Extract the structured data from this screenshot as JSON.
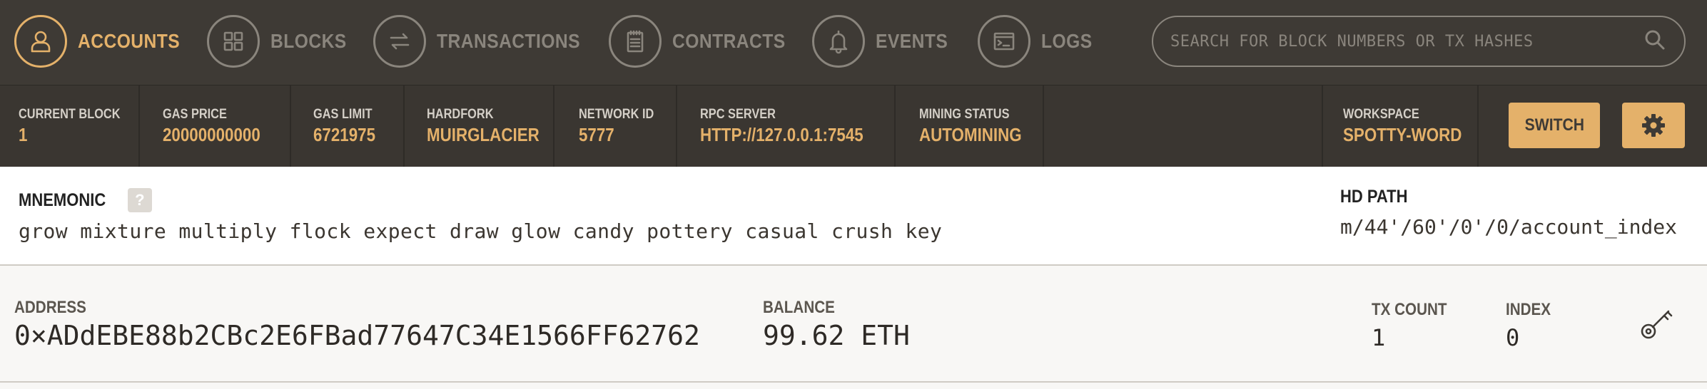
{
  "nav": {
    "items": [
      {
        "label": "ACCOUNTS",
        "icon": "user-icon",
        "active": true
      },
      {
        "label": "BLOCKS",
        "icon": "grid-icon",
        "active": false
      },
      {
        "label": "TRANSACTIONS",
        "icon": "arrows-icon",
        "active": false
      },
      {
        "label": "CONTRACTS",
        "icon": "document-icon",
        "active": false
      },
      {
        "label": "EVENTS",
        "icon": "bell-icon",
        "active": false
      },
      {
        "label": "LOGS",
        "icon": "terminal-icon",
        "active": false
      }
    ],
    "search_placeholder": "SEARCH FOR BLOCK NUMBERS OR TX HASHES"
  },
  "status": {
    "current_block": {
      "label": "CURRENT BLOCK",
      "value": "1"
    },
    "gas_price": {
      "label": "GAS PRICE",
      "value": "20000000000"
    },
    "gas_limit": {
      "label": "GAS LIMIT",
      "value": "6721975"
    },
    "hardfork": {
      "label": "HARDFORK",
      "value": "MUIRGLACIER"
    },
    "network_id": {
      "label": "NETWORK ID",
      "value": "5777"
    },
    "rpc_server": {
      "label": "RPC SERVER",
      "value": "HTTP://127.0.0.1:7545"
    },
    "mining_status": {
      "label": "MINING STATUS",
      "value": "AUTOMINING"
    },
    "workspace": {
      "label": "WORKSPACE",
      "value": "SPOTTY-WORD"
    },
    "switch_label": "SWITCH"
  },
  "mnemonic": {
    "label": "MNEMONIC",
    "help": "?",
    "words": "grow mixture multiply flock expect draw glow candy pottery casual crush key",
    "hd_path_label": "HD PATH",
    "hd_path_value": "m/44'/60'/0'/0/account_index"
  },
  "accounts": [
    {
      "address_label": "ADDRESS",
      "address": "0×ADdEBE88b2CBc2E6FBad77647C34E1566FF62762",
      "balance_label": "BALANCE",
      "balance": "99.62 ETH",
      "tx_count_label": "TX COUNT",
      "tx_count": "1",
      "index_label": "INDEX",
      "index": "0"
    }
  ],
  "colors": {
    "accent": "#e4b16a",
    "nav_bg": "#3e3a35",
    "status_bg": "#3a3631",
    "muted": "#8a857d"
  }
}
